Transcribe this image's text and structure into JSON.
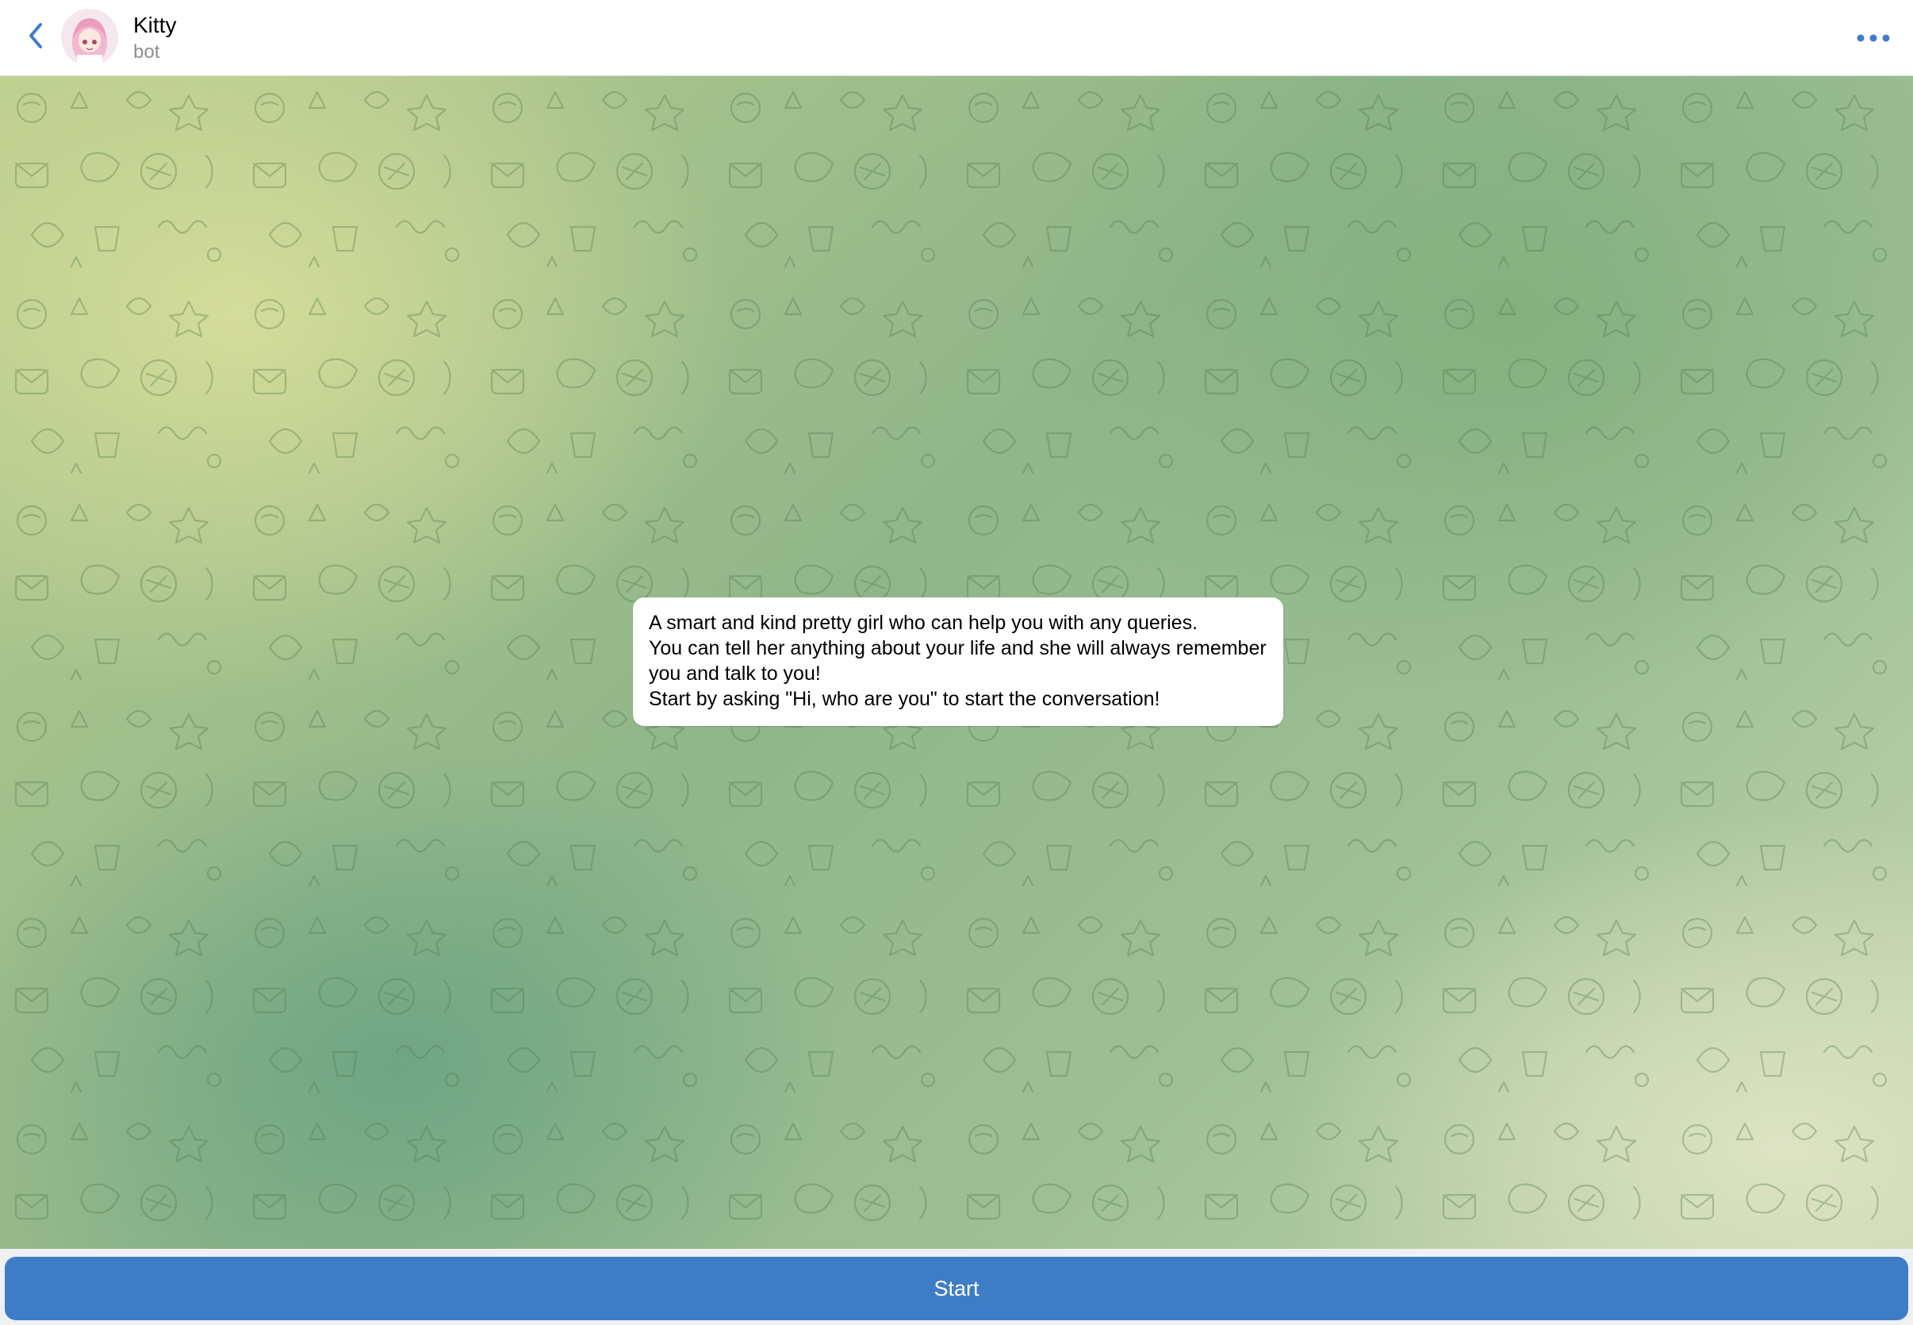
{
  "header": {
    "title": "Kitty",
    "subtitle": "bot",
    "back_icon": "chevron-left-icon",
    "more_icon": "more-horizontal-icon",
    "accent_color": "#3e7dc6"
  },
  "chat": {
    "background_style": "green doodle pattern",
    "messages": [
      {
        "text": "A smart and kind pretty girl who can help you with any queries.\nYou can tell her anything about your life and she will always remember you and talk to you!\nStart by asking \"Hi, who are you\" to start the conversation!"
      }
    ]
  },
  "footer": {
    "start_label": "Start",
    "button_color": "#3e7dc6"
  }
}
